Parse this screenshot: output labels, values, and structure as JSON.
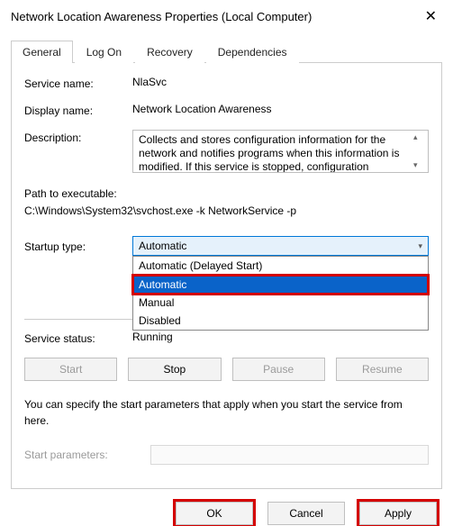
{
  "window": {
    "title": "Network Location Awareness Properties (Local Computer)"
  },
  "tabs": {
    "general": "General",
    "log_on": "Log On",
    "recovery": "Recovery",
    "dependencies": "Dependencies"
  },
  "fields": {
    "service_name_label": "Service name:",
    "service_name_value": "NlaSvc",
    "display_name_label": "Display name:",
    "display_name_value": "Network Location Awareness",
    "description_label": "Description:",
    "description_value": "Collects and stores configuration information for the network and notifies programs when this information is modified. If this service is stopped, configuration",
    "path_label": "Path to executable:",
    "path_value": "C:\\Windows\\System32\\svchost.exe -k NetworkService -p",
    "startup_label": "Startup type:",
    "startup_value": "Automatic",
    "status_label": "Service status:",
    "status_value": "Running",
    "hint": "You can specify the start parameters that apply when you start the service from here.",
    "start_params_label": "Start parameters:",
    "start_params_value": ""
  },
  "startup_options": {
    "delayed": "Automatic (Delayed Start)",
    "automatic": "Automatic",
    "manual": "Manual",
    "disabled": "Disabled"
  },
  "buttons": {
    "start": "Start",
    "stop": "Stop",
    "pause": "Pause",
    "resume": "Resume",
    "ok": "OK",
    "cancel": "Cancel",
    "apply": "Apply"
  }
}
